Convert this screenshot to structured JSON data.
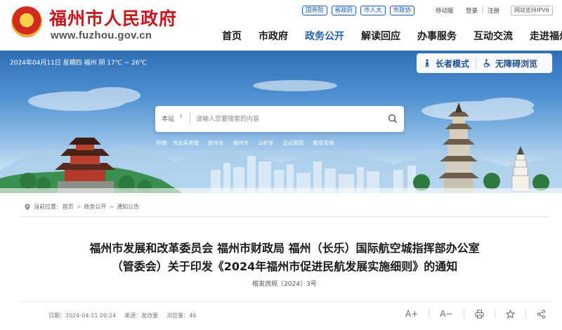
{
  "header": {
    "site_title": "福州市人民政府",
    "site_domain": "www.fuzhou.gov.cn",
    "top_links": [
      "国务院",
      "省政府",
      "市人大",
      "市政协"
    ],
    "mobile": "移动版",
    "login": "登录",
    "register": "注册",
    "ipv6": "网站支持IPV6",
    "nav": [
      "首页",
      "市政府",
      "政务公开",
      "解读回应",
      "办事服务",
      "互动交流",
      "走进福州"
    ],
    "active_nav": "政务公开"
  },
  "banner": {
    "date_weather": "2024年04月11日 星期四  福州 阴 17℃ ~ 26℃",
    "elder_mode": "长者模式",
    "accessible": "无障碍浏览",
    "search": {
      "scope": "本站",
      "placeholder": "请输入您要搜索的内容"
    },
    "hot_label": "热搜:",
    "hot_items": [
      "市长吴贤德",
      "副市长",
      "福州市",
      "公积金",
      "定点医院",
      "教育安排"
    ]
  },
  "content": {
    "breadcrumb_label": "当前位置:",
    "breadcrumb": [
      "首页",
      "政务公开",
      "通知公告"
    ],
    "title_line1": "福州市发展和改革委员会 福州市财政局 福州（长乐）国际航空城指挥部办公室",
    "title_line2": "（管委会）关于印发《2024年福州市促进民航发展实施细则》的通知",
    "doc_number": "榕发改规〔2024〕3号",
    "meta": {
      "date": "日期：2024-04-11 09:24",
      "source": "来源：发改委",
      "views": "浏览量：46"
    },
    "tools": {
      "font_up": "A+",
      "font_down": "A−"
    }
  },
  "colors": {
    "brand_red": "#c8161d",
    "nav_blue": "#1e5fad",
    "banner_top": "#2f6fb7"
  }
}
